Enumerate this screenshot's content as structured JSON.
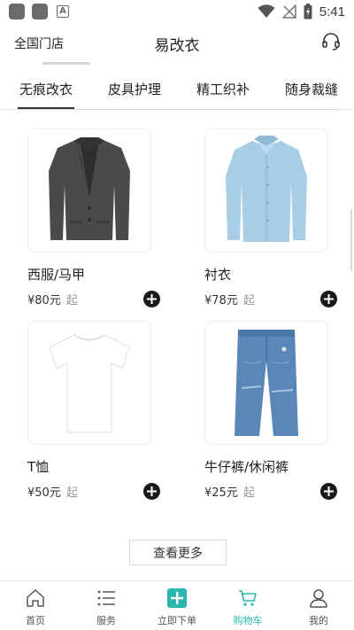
{
  "status_bar": {
    "time": "5:41"
  },
  "header": {
    "left_label": "全国门店",
    "title": "易改衣",
    "right_icon": "headset-icon"
  },
  "tabs": [
    {
      "label": "无痕改衣",
      "active": true
    },
    {
      "label": "皮具护理",
      "active": false
    },
    {
      "label": "精工织补",
      "active": false
    },
    {
      "label": "随身裁缝",
      "active": false
    }
  ],
  "products": [
    {
      "name": "西服/马甲",
      "price": "¥80元",
      "suffix": "起",
      "image": "blazer"
    },
    {
      "name": "衬衣",
      "price": "¥78元",
      "suffix": "起",
      "image": "shirt"
    },
    {
      "name": "T恤",
      "price": "¥50元",
      "suffix": "起",
      "image": "tshirt"
    },
    {
      "name": "牛仔裤/休闲裤",
      "price": "¥25元",
      "suffix": "起",
      "image": "jeans"
    }
  ],
  "more_button": "查看更多",
  "bottom_nav": [
    {
      "label": "首页",
      "icon": "home-icon",
      "active": false
    },
    {
      "label": "服务",
      "icon": "list-icon",
      "active": false
    },
    {
      "label": "立即下单",
      "icon": "plus-square-icon",
      "active": false
    },
    {
      "label": "购物车",
      "icon": "cart-icon",
      "active": true
    },
    {
      "label": "我的",
      "icon": "user-icon",
      "active": false
    }
  ],
  "colors": {
    "accent": "#2bb7b0",
    "text": "#222222",
    "add_button": "#1a1a1a"
  }
}
